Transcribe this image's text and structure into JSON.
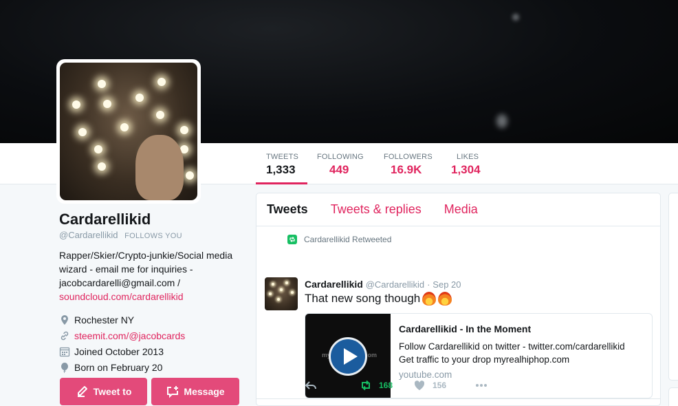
{
  "stats": [
    {
      "label": "TWEETS",
      "value": "1,333",
      "active": true
    },
    {
      "label": "FOLLOWING",
      "value": "449"
    },
    {
      "label": "FOLLOWERS",
      "value": "16.9K"
    },
    {
      "label": "LIKES",
      "value": "1,304"
    }
  ],
  "profile": {
    "name": "Cardarellikid",
    "handle": "@Cardarellikid",
    "follows_you": "FOLLOWS YOU",
    "bio": "Rapper/Skier/Crypto-junkie/Social media wizard - email me for inquiries - jacobcardarelli@gmail.com /",
    "bio_link": "soundcloud.com/cardarellikid",
    "location": "Rochester NY",
    "website": "steemit.com/@jacobcards",
    "joined": "Joined October 2013",
    "born": "Born on February 20"
  },
  "buttons": {
    "tweet_to": "Tweet to",
    "message": "Message"
  },
  "tabs": [
    "Tweets",
    "Tweets & replies",
    "Media"
  ],
  "tweet": {
    "retweet_label": "Cardarellikid Retweeted",
    "author": "Cardarellikid",
    "handle": "@Cardarellikid",
    "date": "Sep 20",
    "text": "That new song though",
    "card": {
      "title": "Cardarellikid - In the Moment",
      "line1": "Follow Cardarellikid on twitter - twitter.com/cardarellikid",
      "line2": "Get traffic to your drop myrealhiphop.com",
      "site": "youtube.com",
      "watermark": "myrealhiphop.com"
    },
    "retweets": "168",
    "likes": "156"
  },
  "colors": {
    "accent": "#e0245e",
    "retweet": "#17bf63"
  }
}
